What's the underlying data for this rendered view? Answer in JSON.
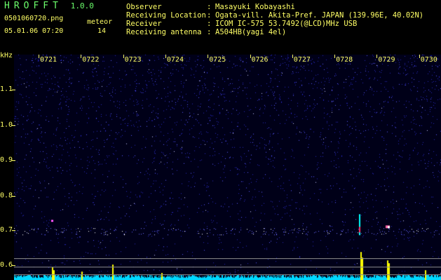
{
  "header": {
    "app_title": "HROFFT",
    "version": "1.0.0",
    "filename": "0501060720.png",
    "meteor_label": "meteor",
    "datetime": "05.01.06 07:20",
    "meteor_count": "14"
  },
  "meta": [
    {
      "key": "Observer",
      "value": "Masayuki Kobayashi"
    },
    {
      "key": "Receiving Location",
      "value": "Ogata-vill. Akita-Pref. JAPAN (139.96E, 40.02N)"
    },
    {
      "key": "Receiver",
      "value": "ICOM IC-575 53.7492(@LCD)MHz USB"
    },
    {
      "key": "Receiving antenna",
      "value": "A504HB(yagi 4el)"
    }
  ],
  "chart_data": {
    "type": "heatmap",
    "ylabel": "kHz",
    "y_ticks": [
      "1.1",
      "1.0",
      "0.9",
      "0.8",
      "0.7",
      "0.6"
    ],
    "x_ticks": [
      "0721",
      "0722",
      "0723",
      "0724",
      "0725",
      "0726",
      "0727",
      "0728",
      "0729",
      "0730"
    ]
  },
  "colors": {
    "label": "#ffff66",
    "title": "#6cff6c",
    "noise": "#3a3aff",
    "signal": "#ffff00",
    "spectrum": "#00e5ff"
  }
}
